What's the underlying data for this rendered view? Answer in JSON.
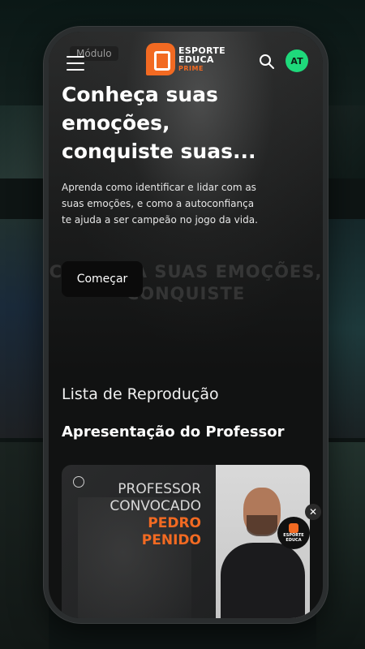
{
  "header": {
    "module_tag": "Módulo",
    "logo": {
      "line1": "ESPORTE",
      "line2": "EDUCA",
      "line3": "PRIME"
    },
    "avatar_initials": "AT"
  },
  "hero": {
    "title": "Conheça suas emoções, conquiste suas...",
    "description": "Aprenda como identificar e lidar com as suas emoções, e como a autoconfiança te ajuda a ser campeão no jogo da vida.",
    "cta_label": "Começar",
    "watermark": "CONHEÇA SUAS EMOÇÕES, CONQUISTE"
  },
  "playlist": {
    "heading": "Lista de Reprodução",
    "subheading": "Apresentação do Professor",
    "card": {
      "line1": "PROFESSOR",
      "line2": "CONVOCADO",
      "line3": "PEDRO PENIDO",
      "badge_line1": "ESPORTE",
      "badge_line2": "EDUCA"
    }
  },
  "close_glyph": "✕",
  "colors": {
    "accent": "#f26a22",
    "avatar": "#1ed97b",
    "background": "#111212"
  }
}
